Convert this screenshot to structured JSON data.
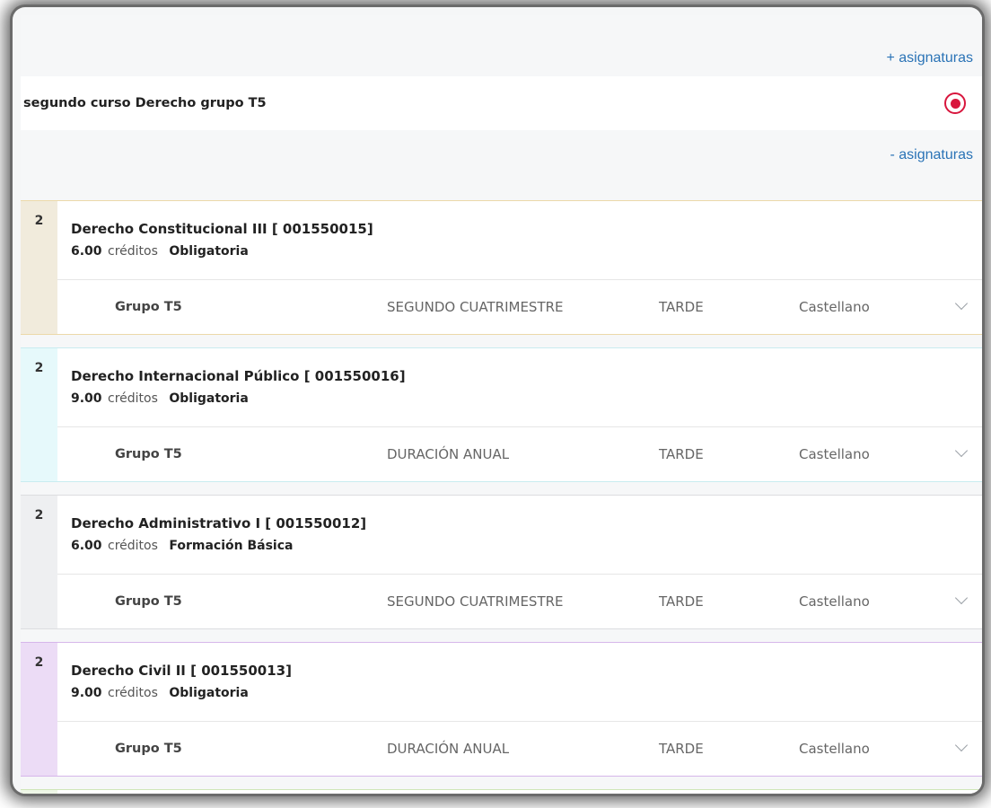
{
  "links": {
    "add_subjects": "+ asignaturas",
    "remove_subjects": "- asignaturas"
  },
  "course": {
    "title": "segundo curso Derecho grupo T5",
    "selected": true
  },
  "colors": {
    "accent": "#2a73b6",
    "radio": "#d8163d"
  },
  "subjects": [
    {
      "year": "2",
      "name": "Derecho Constitucional III [ 001550015]",
      "credits": "6.00",
      "credits_label": "créditos",
      "type": "Obligatoria",
      "group": "Grupo T5",
      "period": "SEGUNDO CUATRIMESTRE",
      "shift": "TARDE",
      "language": "Castellano",
      "sidebar_color": "#f1ebdc",
      "border_color": "#ecd9a9"
    },
    {
      "year": "2",
      "name": "Derecho Internacional Público [ 001550016]",
      "credits": "9.00",
      "credits_label": "créditos",
      "type": "Obligatoria",
      "group": "Grupo T5",
      "period": "DURACIÓN ANUAL",
      "shift": "TARDE",
      "language": "Castellano",
      "sidebar_color": "#e6f9fb",
      "border_color": "#c9ecf0"
    },
    {
      "year": "2",
      "name": "Derecho Administrativo I [ 001550012]",
      "credits": "6.00",
      "credits_label": "créditos",
      "type": "Formación Básica",
      "group": "Grupo T5",
      "period": "SEGUNDO CUATRIMESTRE",
      "shift": "TARDE",
      "language": "Castellano",
      "sidebar_color": "#eeeff1",
      "border_color": "#dcdde0"
    },
    {
      "year": "2",
      "name": "Derecho Civil II [ 001550013]",
      "credits": "9.00",
      "credits_label": "créditos",
      "type": "Obligatoria",
      "group": "Grupo T5",
      "period": "DURACIÓN ANUAL",
      "shift": "TARDE",
      "language": "Castellano",
      "sidebar_color": "#ecdcf6",
      "border_color": "#d6b6ea"
    },
    {
      "year": "2",
      "sidebar_color": "#eef6e6",
      "border_color": "#cfe6b8"
    }
  ]
}
